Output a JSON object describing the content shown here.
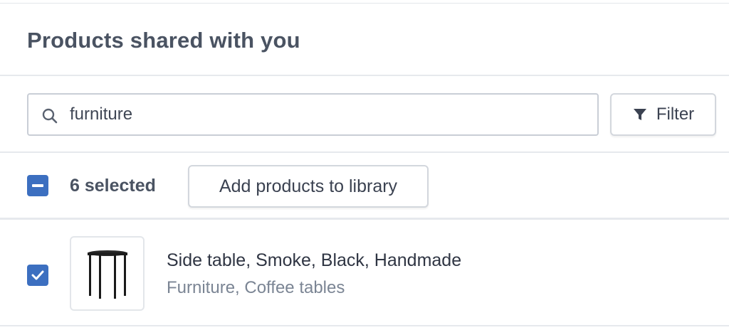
{
  "page": {
    "title": "Products shared with you"
  },
  "search": {
    "value": "furniture",
    "icon": "search-icon"
  },
  "filter": {
    "label": "Filter",
    "icon": "filter-icon"
  },
  "bulk": {
    "selected_label": "6 selected",
    "checkbox_state": "indeterminate",
    "add_button_label": "Add products to library"
  },
  "products": [
    {
      "name": "Side table, Smoke, Black, Handmade",
      "categories": "Furniture, Coffee tables",
      "checked": true,
      "thumbnail": "side-table-image"
    }
  ],
  "colors": {
    "accent": "#3c6fc0",
    "title": "#4a5362",
    "muted": "#7b8594",
    "border": "#d3d7dd"
  }
}
